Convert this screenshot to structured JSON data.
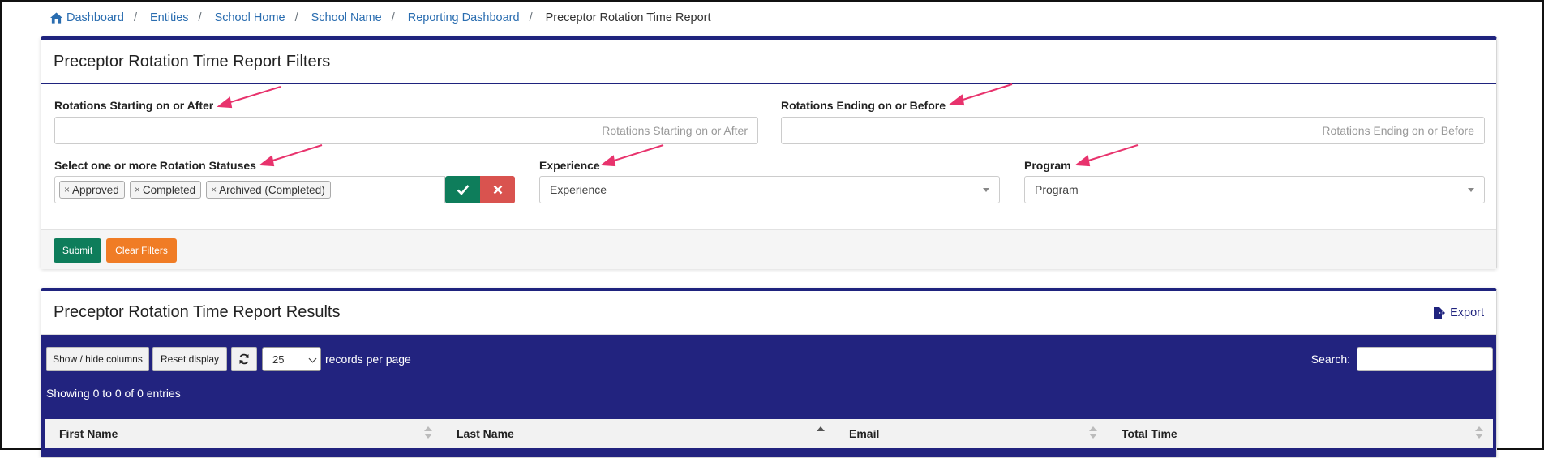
{
  "breadcrumb": {
    "items": [
      "Dashboard",
      "Entities",
      "School Home",
      "School Name",
      "Reporting Dashboard"
    ],
    "separator": "/",
    "current": "Preceptor Rotation Time Report"
  },
  "filters": {
    "title": "Preceptor Rotation Time Report Filters",
    "start_label": "Rotations Starting on or After",
    "start_placeholder": "Rotations Starting on or After",
    "end_label": "Rotations Ending on or Before",
    "end_placeholder": "Rotations Ending on or Before",
    "statuses_label": "Select one or more Rotation Statuses",
    "statuses_selected": [
      "Approved",
      "Completed",
      "Archived (Completed)"
    ],
    "tag_remove": "×",
    "experience_label": "Experience",
    "experience_value": "Experience",
    "program_label": "Program",
    "program_value": "Program",
    "submit_label": "Submit",
    "clear_label": "Clear Filters"
  },
  "results": {
    "title": "Preceptor Rotation Time Report Results",
    "export_label": "Export",
    "show_hide_label": "Show / hide columns",
    "reset_label": "Reset display",
    "page_length": "25",
    "records_per_page": "records per page",
    "search_label": "Search:",
    "info": "Showing 0 to 0 of 0 entries",
    "columns": [
      "First Name",
      "Last Name",
      "Email",
      "Total Time"
    ]
  },
  "colors": {
    "brand_navy": "#1f237e",
    "panel_blue": "#22237f",
    "success": "#0e7d5b",
    "danger": "#d9534f",
    "warning": "#f07c25",
    "annotation": "#e8336d",
    "link": "#2a6db0"
  }
}
